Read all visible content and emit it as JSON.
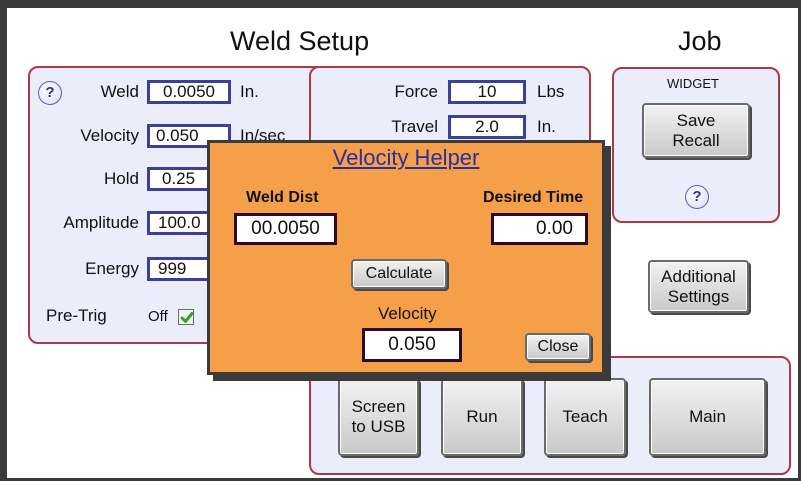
{
  "header": {
    "title": "Weld Setup",
    "job_title": "Job"
  },
  "left_panel": {
    "rows": [
      {
        "label": "Weld",
        "value": "0.0050",
        "unit": "In."
      },
      {
        "label": "Velocity",
        "value": "0.050",
        "unit": "In/sec"
      },
      {
        "label": "Hold",
        "value": "0.25"
      },
      {
        "label": "Amplitude",
        "value": "100.0"
      },
      {
        "label": "Energy",
        "value": "999"
      }
    ],
    "pretrig": {
      "label": "Pre-Trig",
      "state": "Off",
      "checked": true
    }
  },
  "mid_panel": {
    "force": {
      "label": "Force",
      "value": "10",
      "unit": "Lbs"
    },
    "travel": {
      "label": "Travel",
      "value": "2.0",
      "unit": "In."
    }
  },
  "job_panel": {
    "widget": "WIDGET",
    "save_recall": "Save\nRecall"
  },
  "additional_settings": "Additional\nSettings",
  "bottom_buttons": {
    "screen_usb": "Screen\nto USB",
    "run": "Run",
    "teach": "Teach",
    "main": "Main"
  },
  "dialog": {
    "title": "Velocity Helper",
    "weld_dist_label": "Weld Dist",
    "weld_dist_value": "00.0050",
    "desired_time_label": "Desired Time",
    "desired_time_value": "0.00",
    "calculate": "Calculate",
    "velocity_label": "Velocity",
    "velocity_value": "0.050",
    "close": "Close"
  },
  "colors": {
    "panel_border": "#a83a4a",
    "panel_fill": "#ecedfb",
    "field_border": "#3c3f9c",
    "dialog_fill": "#f5a049",
    "dialog_title": "#2a2fa0"
  }
}
